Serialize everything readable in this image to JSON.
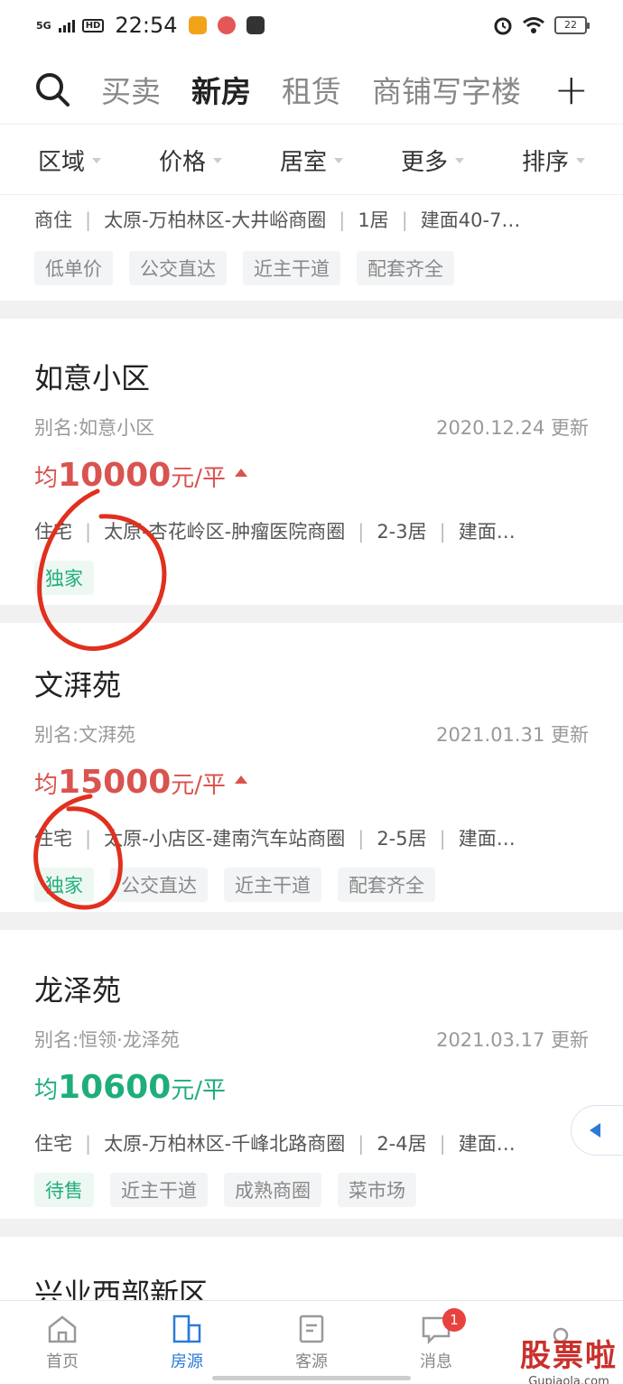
{
  "status_bar": {
    "network": "5G",
    "hd": "HD",
    "time": "22:54",
    "battery": "22"
  },
  "top_nav": {
    "tabs": [
      "买卖",
      "新房",
      "租赁",
      "商铺写字楼"
    ],
    "active_index": 1
  },
  "filters": [
    "区域",
    "价格",
    "居室",
    "更多",
    "排序"
  ],
  "partial_card": {
    "meta": [
      "商住",
      "太原-万柏林区-大井峪商圈",
      "1居",
      "建面40-7…"
    ],
    "tags": [
      "低单价",
      "公交直达",
      "近主干道",
      "配套齐全"
    ]
  },
  "listings": [
    {
      "name": "如意小区",
      "alias": "别名:如意小区",
      "updated": "2020.12.24 更新",
      "price_prefix": "均",
      "price_value": "10000",
      "price_unit": "元/平",
      "meta": [
        "住宅",
        "太原-杏花岭区-肿瘤医院商圈",
        "2-3居",
        "建面…"
      ],
      "tags": [
        "独家"
      ]
    },
    {
      "name": "文湃苑",
      "alias": "别名:文湃苑",
      "updated": "2021.01.31 更新",
      "price_prefix": "均",
      "price_value": "15000",
      "price_unit": "元/平",
      "meta": [
        "住宅",
        "太原-小店区-建南汽车站商圈",
        "2-5居",
        "建面…"
      ],
      "tags": [
        "独家",
        "公交直达",
        "近主干道",
        "配套齐全"
      ]
    },
    {
      "name": "龙泽苑",
      "alias": "别名:恒领·龙泽苑",
      "updated": "2021.03.17 更新",
      "price_prefix": "均",
      "price_value": "10600",
      "price_unit": "元/平",
      "meta": [
        "住宅",
        "太原-万柏林区-千峰北路商圈",
        "2-4居",
        "建面…"
      ],
      "tags": [
        "待售",
        "近主干道",
        "成熟商圈",
        "菜市场"
      ]
    }
  ],
  "next_card_title": "兴业西部新区",
  "bottom_nav": {
    "items": [
      "首页",
      "房源",
      "客源",
      "消息",
      ""
    ],
    "active_index": 1,
    "message_badge": "1"
  },
  "watermark": {
    "cn": "股票啦",
    "en": "Gupiaola.com"
  },
  "colors": {
    "accent": "#2a7ad6",
    "price_red": "#d9534f",
    "price_green": "#1fae7a",
    "annotation": "#e0301e"
  }
}
